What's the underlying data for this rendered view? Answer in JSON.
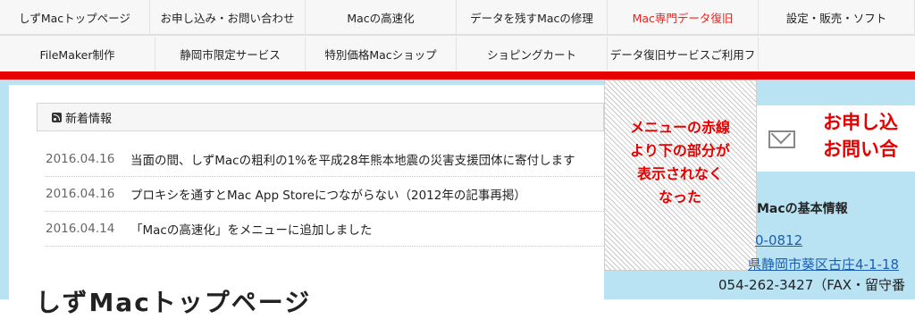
{
  "nav": {
    "row1": [
      {
        "label": "しずMacトップページ",
        "active": false
      },
      {
        "label": "お申し込み・お問い合わせ",
        "active": false
      },
      {
        "label": "Macの高速化",
        "active": false
      },
      {
        "label": "データを残すMacの修理",
        "active": false
      },
      {
        "label": "Mac専門データ復旧",
        "active": true
      },
      {
        "label": "設定・販売・ソフト",
        "active": false
      }
    ],
    "row2": [
      {
        "label": "FileMaker制作"
      },
      {
        "label": "静岡市限定サービス"
      },
      {
        "label": "特別価格Macショップ"
      },
      {
        "label": "ショピングカート"
      },
      {
        "label": "データ復旧サービスご利用フ"
      }
    ]
  },
  "news": {
    "title": "新着情報",
    "items": [
      {
        "date": "2016.04.16",
        "text": "当面の間、しずMacの粗利の1%を平成28年熊本地震の災害支援団体に寄付します"
      },
      {
        "date": "2016.04.16",
        "text": "プロキシを通すとMac App Storeにつながらない（2012年の記事再掲）"
      },
      {
        "date": "2016.04.14",
        "text": "「Macの高速化」をメニューに追加しました"
      }
    ]
  },
  "page_heading": "しずMacトップページ",
  "annotation": [
    "メニューの赤線",
    "より下の部分が",
    "表示されなく",
    "なった"
  ],
  "sidebar": {
    "contact_line1": "お申し込",
    "contact_line2": "お問い合",
    "info_title": "Macの基本情報",
    "zip": "0-0812",
    "address": "県静岡市葵区古庄4-1-18",
    "phone": "054-262-3427（FAX・留守番"
  },
  "colors": {
    "accent": "#e60000",
    "sidebar_bg": "#b9e3f2",
    "link": "#1a5fb4"
  }
}
